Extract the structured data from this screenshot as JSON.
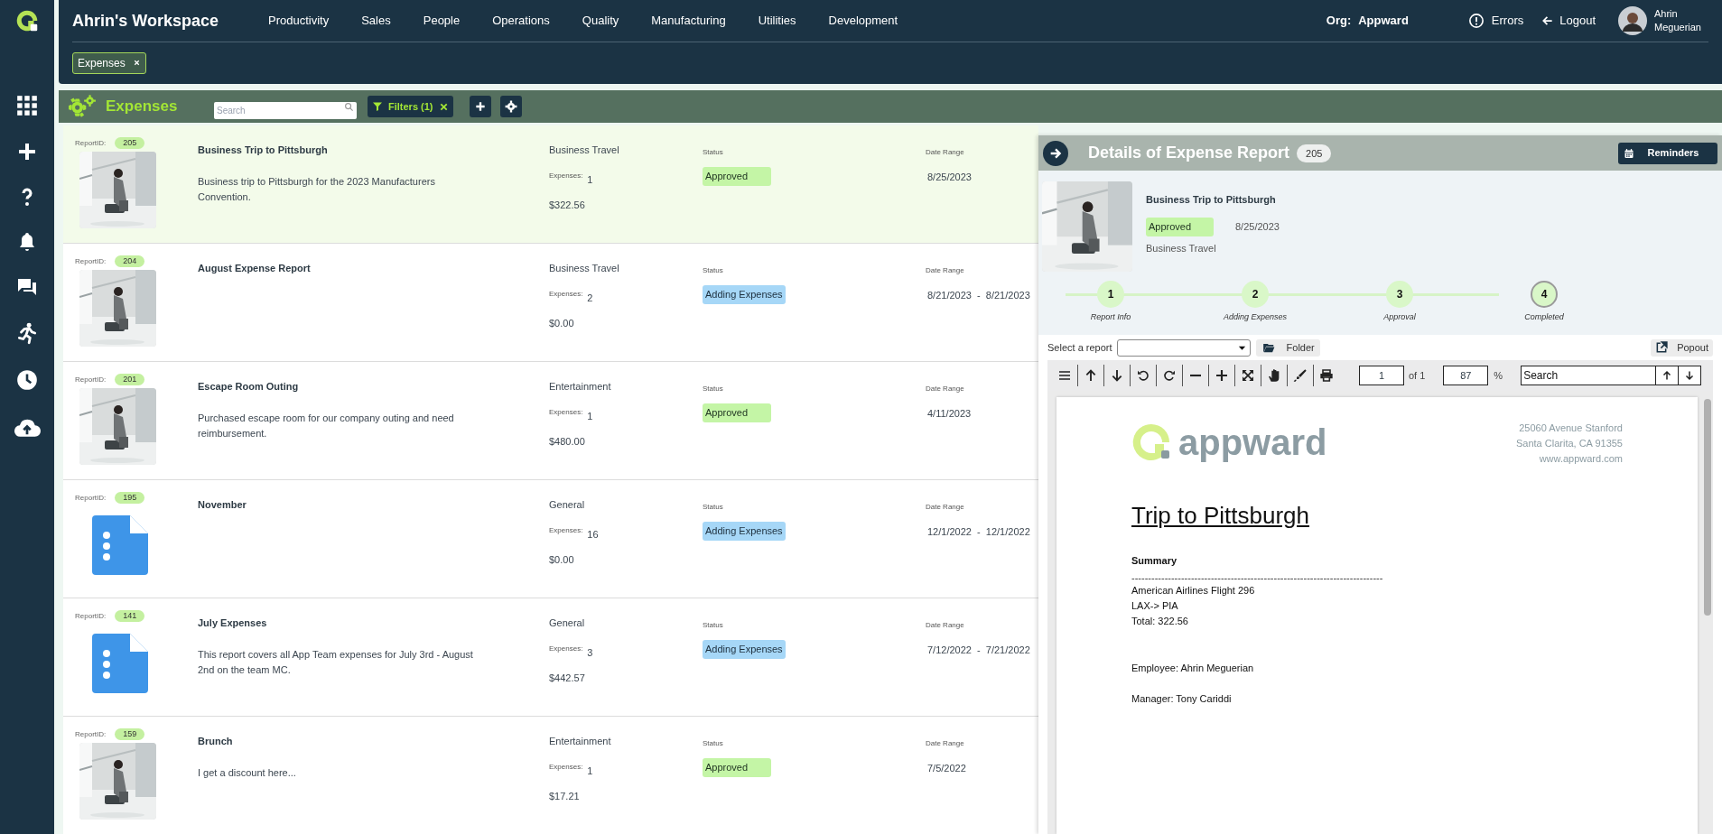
{
  "header": {
    "workspace_title": "Ahrin's Workspace",
    "nav": [
      "Productivity",
      "Sales",
      "People",
      "Operations",
      "Quality",
      "Manufacturing",
      "Utilities",
      "Development"
    ],
    "org_label": "Org:",
    "org_value": "Appward",
    "errors": "Errors",
    "logout": "Logout",
    "user_name": "Ahrin Meguerian"
  },
  "open_tabs": [
    {
      "label": "Expenses"
    }
  ],
  "toolbar": {
    "title": "Expenses",
    "search_placeholder": "Search",
    "filters": "Filters (1)"
  },
  "reports": [
    {
      "id_label": "ReportID:",
      "id": "205",
      "title": "Business Trip to Pittsburgh",
      "description": "Business trip to Pittsburgh for the 2023 Manufacturers Convention.",
      "category": "Business Travel",
      "expenses_label": "Expenses:",
      "expenses_count": "1",
      "total": "$322.56",
      "status_label": "Status",
      "status": {
        "text": "Approved",
        "kind": "approved"
      },
      "date_label": "Date Range",
      "date_range": "8/25/2023",
      "selected": true
    },
    {
      "id_label": "ReportID:",
      "id": "204",
      "title": "August Expense Report",
      "category": "Business Travel",
      "expenses_label": "Expenses:",
      "expenses_count": "2",
      "total": "$0.00",
      "status_label": "Status",
      "status": {
        "text": "Adding Expenses",
        "kind": "in_progress"
      },
      "date_label": "Date Range",
      "date_range": "8/21/2023  -  8/21/2023",
      "selected": false
    },
    {
      "id_label": "ReportID:",
      "id": "201",
      "title": "Escape Room Outing",
      "description": "Purchased escape room for our company outing and need reimbursement.",
      "category": "Entertainment",
      "expenses_label": "Expenses:",
      "expenses_count": "1",
      "total": "$480.00",
      "status_label": "Status",
      "status": {
        "text": "Approved",
        "kind": "approved"
      },
      "date_label": "Date Range",
      "date_range": "4/11/2023",
      "selected": false
    },
    {
      "id_label": "ReportID:",
      "id": "195",
      "thumbnail": {
        "kind": "document"
      },
      "title": "November",
      "category": "General",
      "expenses_label": "Expenses:",
      "expenses_count": "16",
      "total": "$0.00",
      "status_label": "Status",
      "status": {
        "text": "Adding Expenses",
        "kind": "in_progress"
      },
      "date_label": "Date Range",
      "date_range": "12/1/2022  -  12/1/2022",
      "selected": false
    },
    {
      "id_label": "ReportID:",
      "id": "141",
      "thumbnail": {
        "kind": "document"
      },
      "title": "July Expenses",
      "description": "This report covers all App Team expenses for July 3rd - August 2nd on the team MC.",
      "category": "General",
      "expenses_label": "Expenses:",
      "expenses_count": "3",
      "total": "$442.57",
      "status_label": "Status",
      "status": {
        "text": "Adding Expenses",
        "kind": "in_progress"
      },
      "date_label": "Date Range",
      "date_range": "7/12/2022  -  7/21/2022",
      "selected": false
    },
    {
      "id_label": "ReportID:",
      "id": "159",
      "title": "Brunch",
      "description": "I get a discount here...",
      "category": "Entertainment",
      "expenses_label": "Expenses:",
      "expenses_count": "1",
      "total": "$17.21",
      "status_label": "Status",
      "status": {
        "text": "Approved",
        "kind": "approved"
      },
      "date_label": "Date Range",
      "date_range": "7/5/2022",
      "selected": false
    }
  ],
  "details": {
    "title": "Details of Expense Report",
    "id": "205",
    "reminders": "Reminders",
    "report_title": "Business Trip to Pittsburgh",
    "status": {
      "text": "Approved",
      "kind": "approved"
    },
    "date": "8/25/2023",
    "category": "Business Travel",
    "steps": [
      {
        "number": "1",
        "label": "Report Info",
        "current": false
      },
      {
        "number": "2",
        "label": "Adding Expenses",
        "current": false
      },
      {
        "number": "3",
        "label": "Approval",
        "current": false
      },
      {
        "number": "4",
        "label": "Completed",
        "current": true
      }
    ],
    "select_label": "Select a report",
    "folder": "Folder",
    "popout": "Popout"
  },
  "viewer": {
    "page": "1",
    "page_of": "of 1",
    "zoom": "87",
    "percent": "%",
    "search_placeholder": "Search"
  },
  "document": {
    "logo_text": "appward",
    "address": [
      "25060 Avenue Stanford",
      "Santa Clarita, CA 91355",
      "www.appward.com"
    ],
    "heading": "Trip to Pittsburgh",
    "summary_label": "Summary",
    "rule": "----------------------------------------------------------------------------",
    "lines": [
      "American Airlines Flight 296",
      "LAX-> PIA",
      "Total: 322.56"
    ],
    "employee": "Employee: Ahrin Meguerian",
    "manager": "Manager: Tony Cariddi"
  }
}
